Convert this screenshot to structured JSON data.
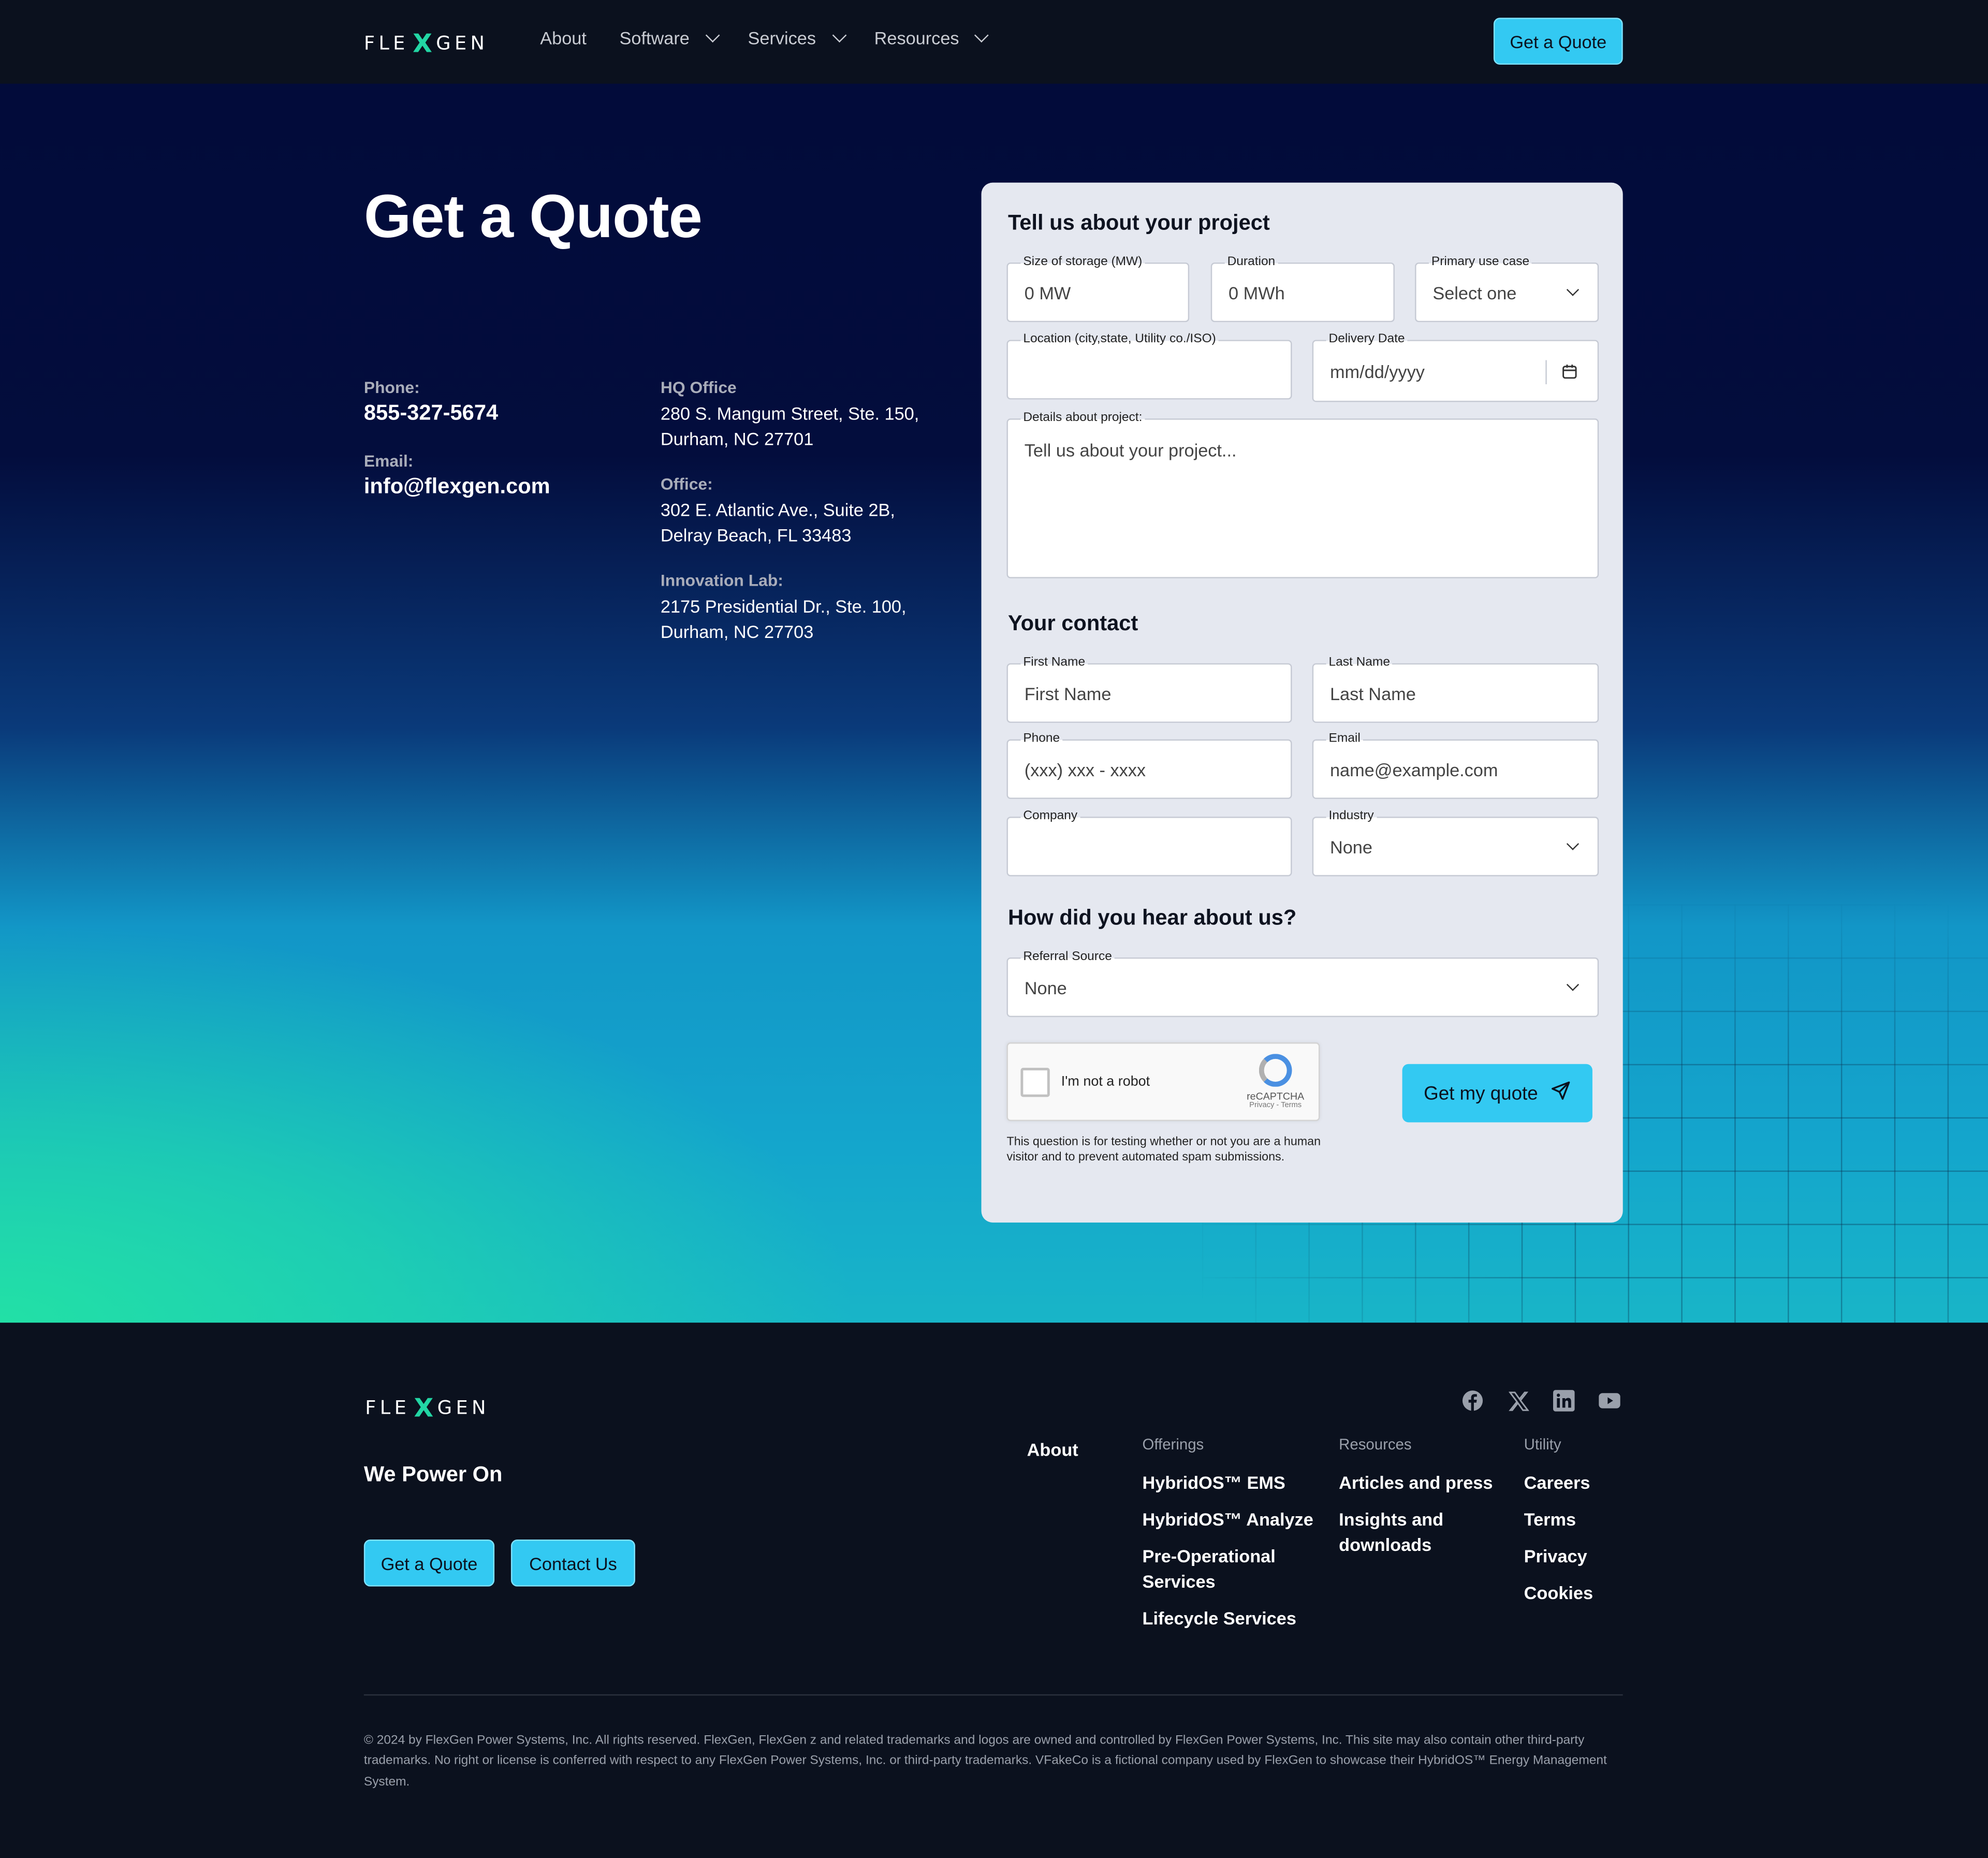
{
  "nav": {
    "logo_left": "FLE",
    "logo_x": "X",
    "logo_right": "GEN",
    "links": [
      "About",
      "Software",
      "Services",
      "Resources"
    ],
    "cta": "Get a Quote"
  },
  "hero": {
    "title": "Get a Quote",
    "phone_label": "Phone:",
    "phone": "855-327-5674",
    "email_label": "Email:",
    "email": "info@flexgen.com",
    "offices": [
      {
        "label": "HQ Office",
        "line1": "280 S. Mangum Street, Ste. 150,",
        "line2": "Durham, NC 27701"
      },
      {
        "label": "Office:",
        "line1": "302 E. Atlantic Ave., Suite 2B,",
        "line2": "Delray Beach, FL 33483"
      },
      {
        "label": "Innovation Lab:",
        "line1": "2175 Presidential Dr., Ste. 100,",
        "line2": "Durham, NC 27703"
      }
    ]
  },
  "form": {
    "project_title": "Tell us about your project",
    "storage_label": "Size of storage (MW)",
    "storage_placeholder": "0 MW",
    "duration_label": "Duration",
    "duration_placeholder": "0 MWh",
    "use_label": "Primary use case",
    "use_value": "Select one",
    "location_label": "Location (city,state, Utility co./ISO)",
    "location_value": "",
    "date_label": "Delivery Date",
    "date_placeholder": "mm/dd/yyyy",
    "details_label": "Details about project:",
    "details_placeholder": "Tell us about your project...",
    "contact_title": "Your contact",
    "first_label": "First Name",
    "first_placeholder": "First Name",
    "last_label": "Last Name",
    "last_placeholder": "Last Name",
    "phone_label": "Phone",
    "phone_placeholder": "(xxx) xxx - xxxx",
    "email_label": "Email",
    "email_placeholder": "name@example.com",
    "company_label": "Company",
    "company_value": "",
    "industry_label": "Industry",
    "industry_value": "None",
    "hear_title": "How did you hear about us?",
    "referral_label": "Referral Source",
    "referral_value": "None",
    "captcha_text": "I'm not a robot",
    "captcha_brand": "reCAPTCHA",
    "captcha_links": "Privacy - Terms",
    "captcha_note": "This question is for testing whether or not you are a human visitor and to prevent automated spam submissions.",
    "submit": "Get my quote"
  },
  "footer": {
    "tagline": "We Power On",
    "btn_quote": "Get a Quote",
    "btn_contact": "Contact Us",
    "social": [
      "facebook-icon",
      "x-icon",
      "linkedin-icon",
      "youtube-icon"
    ],
    "about": "About",
    "offerings_head": "Offerings",
    "offerings": [
      "HybridOS™ EMS",
      "HybridOS™ Analyze",
      "Pre-Operational Services",
      "Lifecycle Services"
    ],
    "resources_head": "Resources",
    "resources": [
      "Articles and press",
      "Insights and downloads"
    ],
    "utility_head": "Utility",
    "utility": [
      "Careers",
      "Terms",
      "Privacy",
      "Cookies"
    ],
    "legal": "© 2024 by FlexGen Power Systems, Inc. All rights reserved. FlexGen, FlexGen z and related trademarks and logos are owned and controlled by FlexGen Power Systems, Inc. This site may also contain other third-party trademarks. No right or license is conferred with respect to any FlexGen Power Systems, Inc. or third-party trademarks. VFakeCo is a fictional company used by FlexGen to showcase their HybridOS™ Energy Management System."
  },
  "colors": {
    "accent": "#33c9f2",
    "brand_green": "#22d6a4",
    "nav_bg": "#0b111e"
  }
}
